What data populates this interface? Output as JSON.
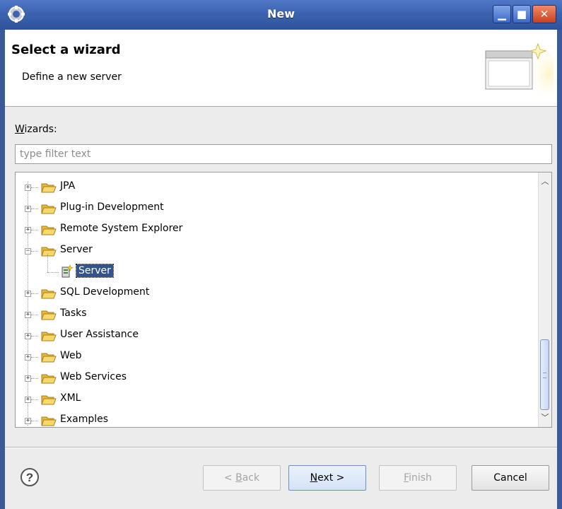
{
  "window": {
    "title": "New"
  },
  "banner": {
    "title": "Select a wizard",
    "description": "Define a new server"
  },
  "wizards": {
    "label_prefix": "W",
    "label_rest": "izards:",
    "filter_placeholder": "type filter text",
    "filter_value": ""
  },
  "tree": {
    "items": [
      {
        "label": "JPA",
        "expanded": false
      },
      {
        "label": "Plug-in Development",
        "expanded": false
      },
      {
        "label": "Remote System Explorer",
        "expanded": false
      },
      {
        "label": "Server",
        "expanded": true
      },
      {
        "label": "Server",
        "child": true,
        "selected": true
      },
      {
        "label": "SQL Development",
        "expanded": false
      },
      {
        "label": "Tasks",
        "expanded": false
      },
      {
        "label": "User Assistance",
        "expanded": false
      },
      {
        "label": "Web",
        "expanded": false
      },
      {
        "label": "Web Services",
        "expanded": false
      },
      {
        "label": "XML",
        "expanded": false
      },
      {
        "label": "Examples",
        "expanded": false
      }
    ]
  },
  "buttons": {
    "back": {
      "prefix": "< ",
      "mnemonic": "B",
      "rest": "ack",
      "enabled": false
    },
    "next": {
      "mnemonic": "N",
      "rest": "ext >",
      "enabled": true
    },
    "finish": {
      "mnemonic": "F",
      "rest": "inish",
      "enabled": false
    },
    "cancel": {
      "label": "Cancel",
      "enabled": true
    }
  },
  "icons": {
    "app": "eclipse-icon",
    "folder": "folder-open-icon",
    "server_wizard": "server-wizard-icon",
    "help": "help-icon"
  },
  "colors": {
    "selection": "#33548a",
    "titlebar": "#3d63b0",
    "folder": "#f2c64a"
  }
}
